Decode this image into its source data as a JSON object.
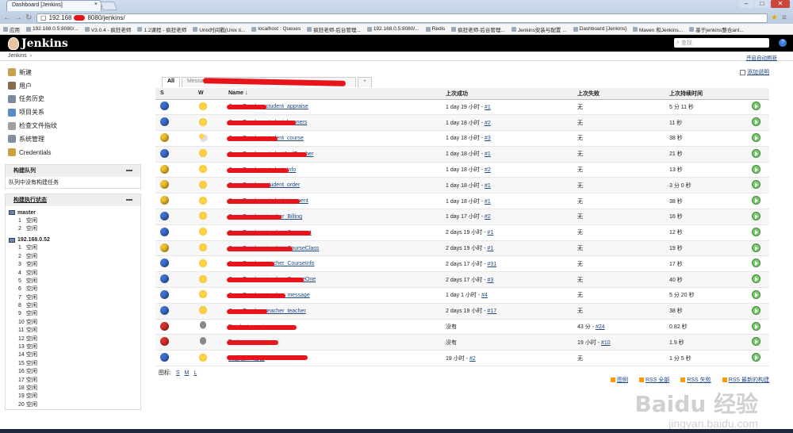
{
  "browser": {
    "tab_title": "Dashboard [Jenkins]",
    "tab_close": "×",
    "win_buttons": [
      "–",
      "□",
      "✕"
    ],
    "address_prefix": "192.168",
    "address_suffix": "8080/jenkins/",
    "bookmarks": [
      "应用",
      "192.168.0.5:8080/...",
      "V3.0.4 - 疯狂老师",
      "1.2课程 - 疯狂老师",
      "Unix时间戳(Unix ti...",
      "localhost : Queues",
      "疯狂老师-后台管理...",
      "192.168.0.5:8080/...",
      "Redis",
      "疯狂老师-后台管理...",
      "Jenkins安装与配置 ...",
      "Dashboard [Jenkins]",
      "Maven 和Jenkins...",
      "基于jenkins整合ant..."
    ]
  },
  "header": {
    "logo_text": "Jenkins",
    "search_placeholder": "查找",
    "help": "?"
  },
  "breadcrumb": {
    "root": "Jenkins",
    "autorefresh": "开启自动刷新"
  },
  "sidebar": {
    "tasks": [
      {
        "label": "新建",
        "color": "#c8a050"
      },
      {
        "label": "用户",
        "color": "#8a6a4a"
      },
      {
        "label": "任务历史",
        "color": "#7a8aa0"
      },
      {
        "label": "项目关系",
        "color": "#5a8ac0"
      },
      {
        "label": "检查文件指纹",
        "color": "#a0a0a0"
      },
      {
        "label": "系统管理",
        "color": "#8090a0"
      },
      {
        "label": "Credentials",
        "color": "#d0a040"
      }
    ],
    "queue_title": "构建队列",
    "queue_empty": "队列中没有构建任务",
    "executors_title": "构建执行状态",
    "computers": [
      {
        "name": "master",
        "executors": [
          {
            "num": "1",
            "status": "空闲"
          },
          {
            "num": "2",
            "status": "空闲"
          }
        ]
      },
      {
        "name": "192.168.0.52",
        "executors": [
          {
            "num": "1",
            "status": "空闲"
          },
          {
            "num": "2",
            "status": "空闲"
          },
          {
            "num": "3",
            "status": "空闲"
          },
          {
            "num": "4",
            "status": "空闲"
          },
          {
            "num": "5",
            "status": "空闲"
          },
          {
            "num": "6",
            "status": "空闲"
          },
          {
            "num": "7",
            "status": "空闲"
          },
          {
            "num": "8",
            "status": "空闲"
          },
          {
            "num": "9",
            "status": "空闲"
          },
          {
            "num": "10",
            "status": "空闲"
          },
          {
            "num": "11",
            "status": "空闲"
          },
          {
            "num": "12",
            "status": "空闲"
          },
          {
            "num": "13",
            "status": "空闲"
          },
          {
            "num": "14",
            "status": "空闲"
          },
          {
            "num": "15",
            "status": "空闲"
          },
          {
            "num": "16",
            "status": "空闲"
          },
          {
            "num": "17",
            "status": "空闲"
          },
          {
            "num": "18",
            "status": "空闲"
          },
          {
            "num": "19",
            "status": "空闲"
          },
          {
            "num": "20",
            "status": "空闲"
          }
        ]
      }
    ]
  },
  "main": {
    "add_view": "添加说明",
    "tabs": [
      "All",
      "Message",
      "+"
    ],
    "columns": {
      "s": "S",
      "w": "W",
      "name": "Name ↓",
      "last_success": "上次成功",
      "last_failure": "上次失败",
      "last_duration": "上次持续时间"
    },
    "jobs": [
      {
        "status": "blue",
        "weather": "sun",
        "name": "CrazyTeacher_student_appraise",
        "success_text": "1 day 19 小时 - ",
        "success_link": "#1",
        "failure_text": "无",
        "failure_link": "",
        "duration": "5 分 11 秒"
      },
      {
        "status": "blue",
        "weather": "sun",
        "name": "CrazyTeacher_student_banners",
        "success_text": "1 day 18 小时 - ",
        "success_link": "#2",
        "failure_text": "无",
        "failure_link": "",
        "duration": "11 秒"
      },
      {
        "status": "yellow",
        "weather": "cloud",
        "name": "CrazyTeacher_student_course",
        "success_text": "1 day 18 小时 - ",
        "success_link": "#3",
        "failure_text": "无",
        "failure_link": "",
        "duration": "38 秒"
      },
      {
        "status": "blue",
        "weather": "sun",
        "name": "CrazyTeacher_studentAndTeacher",
        "success_text": "1 day 18 小时 - ",
        "success_link": "#1",
        "failure_text": "无",
        "failure_link": "",
        "duration": "21 秒"
      },
      {
        "status": "yellow",
        "weather": "sun",
        "name": "CrazyTeacher_student_info",
        "success_text": "1 day 18 小时 - ",
        "success_link": "#2",
        "failure_text": "无",
        "failure_link": "",
        "duration": "13 秒"
      },
      {
        "status": "yellow",
        "weather": "sun",
        "name": "CrazyTeacher_student_order",
        "success_text": "1 day 18 小时 - ",
        "success_link": "#1",
        "failure_text": "无",
        "failure_link": "",
        "duration": "3 分 0 秒"
      },
      {
        "status": "yellow",
        "weather": "sun",
        "name": "CrazyTeacher_student_payment",
        "success_text": "1 day 18 小时 - ",
        "success_link": "#1",
        "failure_text": "无",
        "failure_link": "",
        "duration": "38 秒"
      },
      {
        "status": "blue",
        "weather": "sun",
        "name": "CrazyTeacher_teacher_Billing",
        "success_text": "1 day 17 小时 - ",
        "success_link": "#2",
        "failure_text": "无",
        "failure_link": "",
        "duration": "16 秒"
      },
      {
        "status": "blue",
        "weather": "sun",
        "name": "CrazyTeacher_teacher_Comment",
        "success_text": "2 days 19 小时 - ",
        "success_link": "#1",
        "failure_text": "无",
        "failure_link": "",
        "duration": "12 秒"
      },
      {
        "status": "yellow",
        "weather": "sun",
        "name": "CrazyTeacher_teacher_CourseClass",
        "success_text": "2 days 19 小时 - ",
        "success_link": "#1",
        "failure_text": "无",
        "failure_link": "",
        "duration": "19 秒"
      },
      {
        "status": "blue",
        "weather": "sun",
        "name": "CrazyTeacher_teacher_CourseInfo",
        "success_text": "2 days 17 小时 - ",
        "success_link": "#31",
        "failure_text": "无",
        "failure_link": "",
        "duration": "17 秒"
      },
      {
        "status": "blue",
        "weather": "sun",
        "name": "CrazyTeacher_teacher_CourseOne",
        "success_text": "2 days 17 小时 - ",
        "success_link": "#3",
        "failure_text": "无",
        "failure_link": "",
        "duration": "40 秒"
      },
      {
        "status": "blue",
        "weather": "sun",
        "name": "CrazyTeacher_teacher_message",
        "success_text": "1 day 1 小时 - ",
        "success_link": "#4",
        "failure_text": "无",
        "failure_link": "",
        "duration": "5 分 20 秒"
      },
      {
        "status": "blue",
        "weather": "sun",
        "name": "CrazyTeacher_teacher_teacher",
        "success_text": "2 days 19 小时 - ",
        "success_link": "#17",
        "failure_text": "无",
        "failure_link": "",
        "duration": "38 秒"
      },
      {
        "status": "red",
        "weather": "storm",
        "name": "Entelecture_ci",
        "success_text": "没有",
        "success_link": "",
        "failure_text": "43 分 - ",
        "failure_link": "#24",
        "duration": "0.82 秒"
      },
      {
        "status": "red",
        "weather": "storm",
        "name": "Testing",
        "success_text": "没有",
        "success_link": "",
        "failure_text": "19 小时 - ",
        "failure_link": "#10",
        "duration": "1.9 秒"
      },
      {
        "status": "blue",
        "weather": "sun",
        "name": "疯狂老师_后台",
        "success_text": "19 小时 - ",
        "success_link": "#2",
        "failure_text": "无",
        "failure_link": "",
        "duration": "1 分 5 秒"
      }
    ],
    "legend_label": "图标:",
    "sizes": [
      "S",
      "M",
      "L"
    ],
    "rss_links": [
      "图例",
      "RSS 全部",
      "RSS 失败",
      "RSS 最新的构建"
    ]
  },
  "watermark": {
    "text": "Baidu 经验",
    "sub": "jingyan.baidu.com"
  },
  "colors": {
    "blue": "#3d6fd0",
    "yellow": "#f2c12e",
    "red": "#d9302a"
  }
}
